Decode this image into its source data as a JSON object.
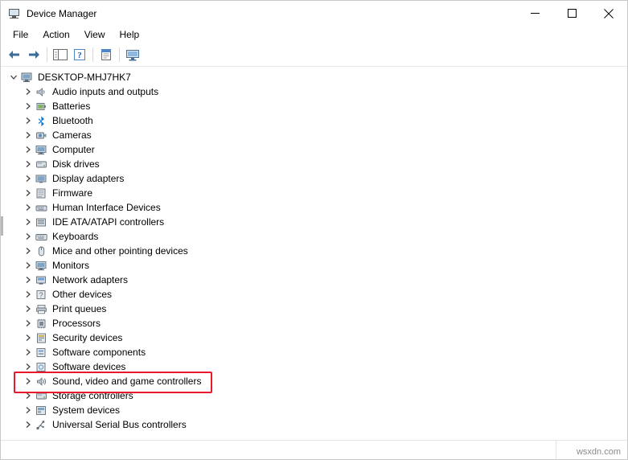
{
  "window": {
    "title": "Device Manager",
    "icon": "monitor-icon",
    "caption": {
      "minimize": "minimize-icon",
      "maximize": "maximize-icon",
      "close": "close-icon"
    }
  },
  "menubar": {
    "items": [
      {
        "label": "File",
        "name": "menu-file"
      },
      {
        "label": "Action",
        "name": "menu-action"
      },
      {
        "label": "View",
        "name": "menu-view"
      },
      {
        "label": "Help",
        "name": "menu-help"
      }
    ]
  },
  "toolbar": {
    "buttons": [
      {
        "name": "back-button",
        "icon": "back-arrow-icon"
      },
      {
        "name": "forward-button",
        "icon": "forward-arrow-icon"
      },
      {
        "name": "show-hide-console-tree-button",
        "icon": "console-tree-icon"
      },
      {
        "name": "help-button",
        "icon": "question-mark-icon"
      },
      {
        "name": "properties-button",
        "icon": "properties-icon"
      },
      {
        "name": "scan-for-hardware-changes-button",
        "icon": "scan-hardware-icon"
      }
    ]
  },
  "tree": {
    "root": {
      "label": "DESKTOP-MHJ7HK7",
      "icon": "computer-icon",
      "expanded": true
    },
    "items": [
      {
        "label": "Audio inputs and outputs",
        "icon": "speaker-icon"
      },
      {
        "label": "Batteries",
        "icon": "battery-icon"
      },
      {
        "label": "Bluetooth",
        "icon": "bluetooth-icon"
      },
      {
        "label": "Cameras",
        "icon": "camera-icon"
      },
      {
        "label": "Computer",
        "icon": "computer-icon"
      },
      {
        "label": "Disk drives",
        "icon": "disk-drive-icon"
      },
      {
        "label": "Display adapters",
        "icon": "display-adapter-icon"
      },
      {
        "label": "Firmware",
        "icon": "firmware-icon"
      },
      {
        "label": "Human Interface Devices",
        "icon": "hid-icon"
      },
      {
        "label": "IDE ATA/ATAPI controllers",
        "icon": "ide-controller-icon"
      },
      {
        "label": "Keyboards",
        "icon": "keyboard-icon"
      },
      {
        "label": "Mice and other pointing devices",
        "icon": "mouse-icon"
      },
      {
        "label": "Monitors",
        "icon": "monitor-icon"
      },
      {
        "label": "Network adapters",
        "icon": "network-adapter-icon"
      },
      {
        "label": "Other devices",
        "icon": "other-device-icon"
      },
      {
        "label": "Print queues",
        "icon": "printer-icon"
      },
      {
        "label": "Processors",
        "icon": "processor-icon"
      },
      {
        "label": "Security devices",
        "icon": "security-device-icon"
      },
      {
        "label": "Software components",
        "icon": "software-component-icon"
      },
      {
        "label": "Software devices",
        "icon": "software-device-icon"
      },
      {
        "label": "Sound, video and game controllers",
        "icon": "sound-controller-icon",
        "highlighted": true
      },
      {
        "label": "Storage controllers",
        "icon": "storage-controller-icon"
      },
      {
        "label": "System devices",
        "icon": "system-device-icon"
      },
      {
        "label": "Universal Serial Bus controllers",
        "icon": "usb-controller-icon"
      }
    ]
  },
  "statusbar": {
    "left_text": "",
    "right_text": ""
  },
  "watermark": "wsxdn.com",
  "colors": {
    "highlight": "#e8192c",
    "bluetooth": "#0078d7",
    "accent": "#4a86c8"
  }
}
